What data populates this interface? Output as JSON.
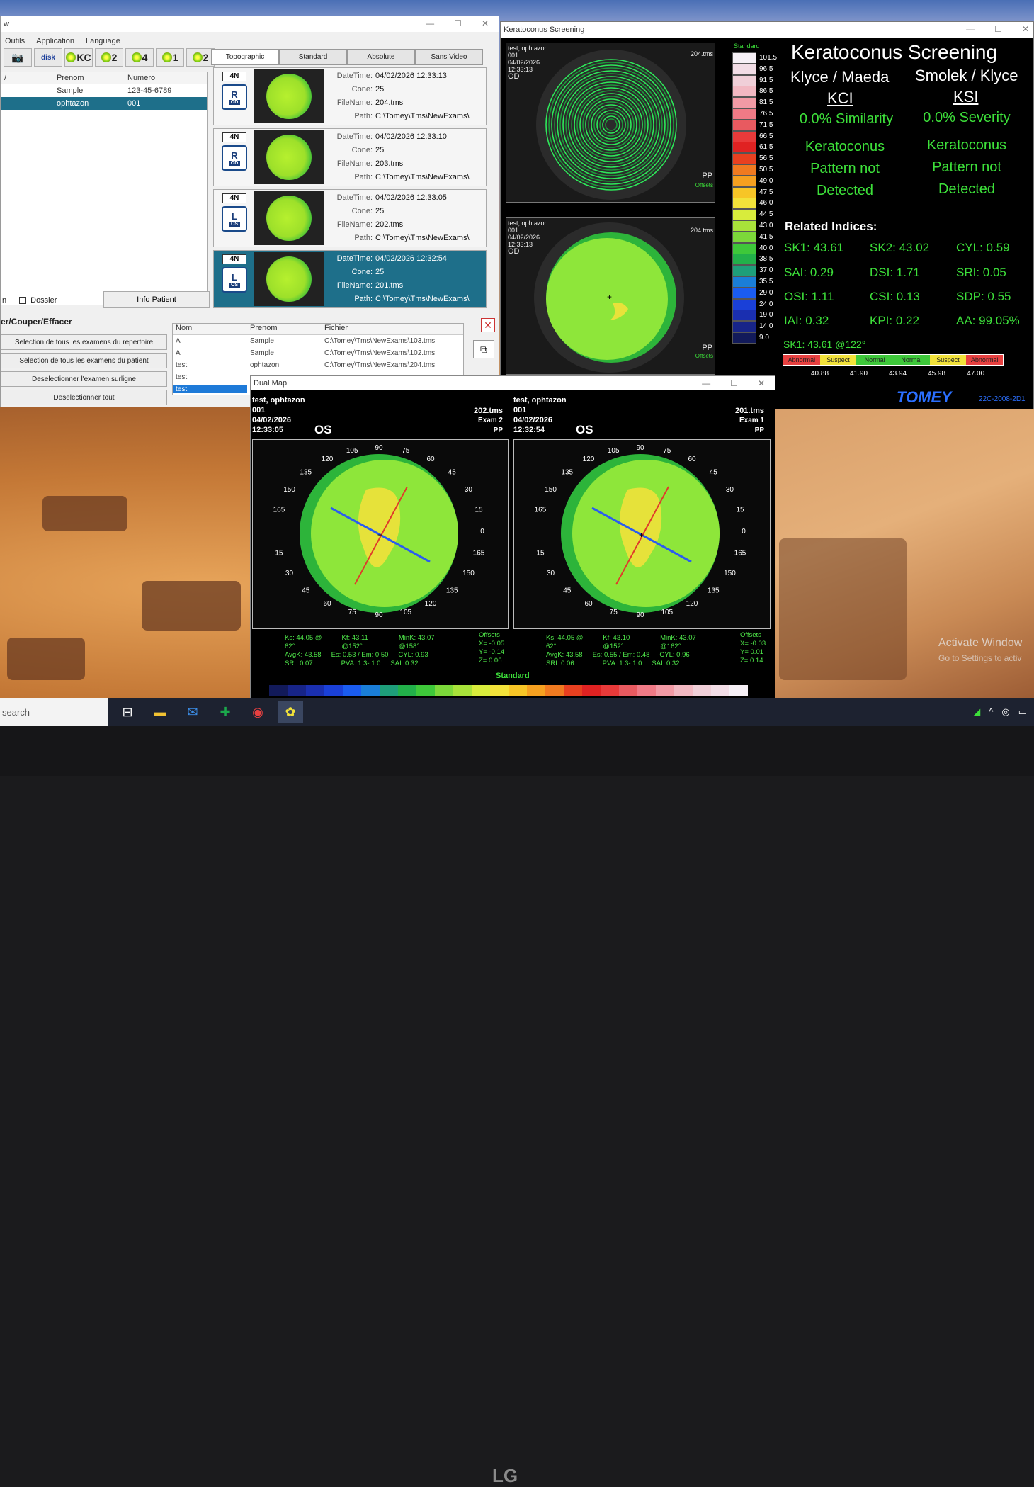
{
  "main": {
    "title": "w",
    "menu": [
      "Outils",
      "Application",
      "Language"
    ],
    "toolbar": [
      "📷",
      "disk",
      "KC",
      "2",
      "4",
      "1",
      "2"
    ],
    "tabs": [
      "Topographic",
      "Standard",
      "Absolute",
      "Sans Video"
    ],
    "patient_columns": [
      "/",
      "Prenom",
      "Numero"
    ],
    "patients": [
      {
        "nom": "",
        "prenom": "Sample",
        "numero": "123-45-6789"
      },
      {
        "nom": "",
        "prenom": "ophtazon",
        "numero": "001"
      }
    ],
    "exams": [
      {
        "badge": "4N",
        "eye": "R",
        "side": "OD",
        "datetime": "04/02/2026 12:33:13",
        "cone": "25",
        "filename": "204.tms",
        "path": "C:\\Tomey\\Tms\\NewExams\\"
      },
      {
        "badge": "4N",
        "eye": "R",
        "side": "OD",
        "datetime": "04/02/2026 12:33:10",
        "cone": "25",
        "filename": "203.tms",
        "path": "C:\\Tomey\\Tms\\NewExams\\"
      },
      {
        "badge": "4N",
        "eye": "L",
        "side": "OS",
        "datetime": "04/02/2026 12:33:05",
        "cone": "25",
        "filename": "202.tms",
        "path": "C:\\Tomey\\Tms\\NewExams\\"
      },
      {
        "badge": "4N",
        "eye": "L",
        "side": "OS",
        "datetime": "04/02/2026 12:32:54",
        "cone": "25",
        "filename": "201.tms",
        "path": "C:\\Tomey\\Tms\\NewExams\\"
      }
    ],
    "field_labels": {
      "datetime": "DateTime:",
      "cone": "Cone:",
      "filename": "FileName:",
      "path": "Path:"
    },
    "bottom_left": "n",
    "dossier_label": "Dossier",
    "info_patient": "Info Patient",
    "section_title": "er/Couper/Effacer",
    "actions": [
      "Selection de tous les examens du repertoire",
      "Selection de tous les examens du patient",
      "Deselectionner l'examen surligne",
      "Deselectionner tout"
    ],
    "file_columns": [
      "Nom",
      "Prenom",
      "Fichier"
    ],
    "files": [
      {
        "nom": "A",
        "prenom": "Sample",
        "fichier": "C:\\Tomey\\Tms\\NewExams\\103.tms"
      },
      {
        "nom": "A",
        "prenom": "Sample",
        "fichier": "C:\\Tomey\\Tms\\NewExams\\102.tms"
      },
      {
        "nom": "test",
        "prenom": "ophtazon",
        "fichier": "C:\\Tomey\\Tms\\NewExams\\204.tms"
      },
      {
        "nom": "test",
        "prenom": "",
        "fichier": ""
      },
      {
        "nom": "test",
        "prenom": "",
        "fichier": ""
      }
    ]
  },
  "kc": {
    "window_title": "Keratoconus Screening",
    "topo1": {
      "name": "test, ophtazon",
      "id": "001",
      "date": "04/02/2026",
      "time": "12:33:13",
      "eye": "OD",
      "file": "204.tms",
      "pp": "PP",
      "offsets": "Offsets"
    },
    "topo2": {
      "name": "test, ophtazon",
      "id": "001",
      "date": "04/02/2026",
      "time": "12:33:13",
      "eye": "OD",
      "file": "204.tms",
      "pp": "PP",
      "offsets": "Offsets"
    },
    "scale_title": "Standard",
    "scale_values": [
      "101.5",
      "96.5",
      "91.5",
      "86.5",
      "81.5",
      "76.5",
      "71.5",
      "66.5",
      "61.5",
      "56.5",
      "50.5",
      "49.0",
      "47.5",
      "46.0",
      "44.5",
      "43.0",
      "41.5",
      "40.0",
      "38.5",
      "37.0",
      "35.5",
      "29.0",
      "24.0",
      "19.0",
      "14.0",
      "9.0"
    ],
    "scale_colors": [
      "#f6f0f6",
      "#f2dde6",
      "#f0cfd8",
      "#f2b8c2",
      "#f29aa5",
      "#f07a86",
      "#e85a60",
      "#e83a3a",
      "#e02222",
      "#e84020",
      "#f07a20",
      "#f5a020",
      "#f7c526",
      "#f2e23a",
      "#d8ec3c",
      "#a8e23a",
      "#7cd83a",
      "#3ec83a",
      "#22b04a",
      "#1e9e7a",
      "#1a7ed8",
      "#1a5cf0",
      "#1a40d8",
      "#1a2fb0",
      "#172488",
      "#121a5a"
    ],
    "heading": "Keratoconus Screening",
    "left_title": "Klyce / Maeda",
    "left_code": "KCI",
    "left_pct": "0.0% Similarity",
    "left_result": [
      "Keratoconus",
      "Pattern not",
      "Detected"
    ],
    "right_title": "Smolek / Klyce",
    "right_code": "KSI",
    "right_pct": "0.0% Severity",
    "right_result": [
      "Keratoconus",
      "Pattern not",
      "Detected"
    ],
    "related": "Related Indices:",
    "indices": [
      "SK1: 43.61",
      "SK2: 43.02",
      "CYL: 0.59",
      "SAI: 0.29",
      "DSI: 1.71",
      "SRI: 0.05",
      "OSI: 1.11",
      "CSI: 0.13",
      "SDP: 0.55",
      "IAI: 0.32",
      "KPI: 0.22",
      "AA: 99.05%"
    ],
    "sk1_axis": "SK1: 43.61 @122°",
    "severity": [
      "Abnormal",
      "Suspect",
      "Normal",
      "Normal",
      "Suspect",
      "Abnormal"
    ],
    "severity_colors": [
      "#e84040",
      "#f2e23a",
      "#3ec83a",
      "#3ec83a",
      "#f2e23a",
      "#e84040"
    ],
    "ticks": [
      "40.88",
      "41.90",
      "43.94",
      "45.98",
      "47.00"
    ],
    "brand": "TOMEY",
    "code": "22C-2008-2D1"
  },
  "dual": {
    "window_title": "Dual Map",
    "left": {
      "name": "test, ophtazon",
      "id": "001",
      "date": "04/02/2026",
      "time": "12:33:05",
      "eye": "OS",
      "file": "202.tms",
      "exam": "Exam 2",
      "pp": "PP",
      "stats": [
        "Ks: 44.05 @ 62°",
        "Kf: 43.11 @152°",
        "MinK: 43.07 @158°",
        "AvgK: 43.58",
        "Es: 0.53 / Em: 0.50",
        "CYL: 0.93",
        "SRI: 0.07",
        "PVA: 1.3- 1.0",
        "SAI: 0.32"
      ],
      "offsets": [
        "Offsets",
        "X= -0.05",
        "Y= -0.14",
        "Z= 0.06"
      ]
    },
    "right": {
      "name": "test, ophtazon",
      "id": "001",
      "date": "04/02/2026",
      "time": "12:32:54",
      "eye": "OS",
      "file": "201.tms",
      "exam": "Exam 1",
      "pp": "PP",
      "stats": [
        "Ks: 44.05 @ 62°",
        "Kf: 43.10 @152°",
        "MinK: 43.07 @162°",
        "AvgK: 43.58",
        "Es: 0.55 / Em: 0.48",
        "CYL: 0.96",
        "SRI: 0.06",
        "PVA: 1.3- 1.0",
        "SAI: 0.32"
      ],
      "offsets": [
        "Offsets",
        "X= -0.03",
        "Y= 0.01",
        "Z= 0.14"
      ]
    },
    "scale_title": "Standard",
    "angles": [
      "0",
      "15",
      "30",
      "45",
      "60",
      "75",
      "90",
      "105",
      "120",
      "135",
      "150",
      "165"
    ]
  },
  "desktop": {
    "search": "search",
    "watermark1": "Activate Window",
    "watermark2": "Go to Settings to activ",
    "brand": "LG"
  }
}
